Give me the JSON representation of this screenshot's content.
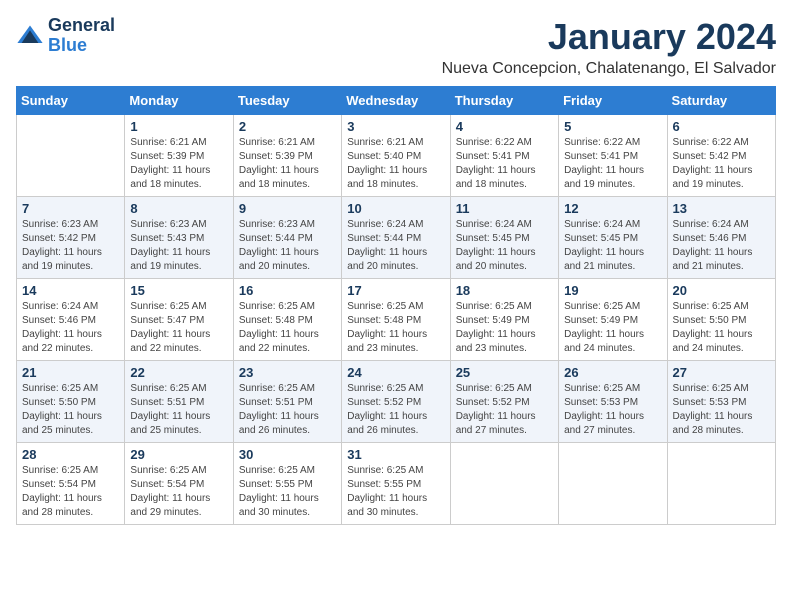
{
  "logo": {
    "line1": "General",
    "line2": "Blue"
  },
  "title": "January 2024",
  "location": "Nueva Concepcion, Chalatenango, El Salvador",
  "days_of_week": [
    "Sunday",
    "Monday",
    "Tuesday",
    "Wednesday",
    "Thursday",
    "Friday",
    "Saturday"
  ],
  "weeks": [
    [
      {
        "day": "",
        "info": ""
      },
      {
        "day": "1",
        "info": "Sunrise: 6:21 AM\nSunset: 5:39 PM\nDaylight: 11 hours\nand 18 minutes."
      },
      {
        "day": "2",
        "info": "Sunrise: 6:21 AM\nSunset: 5:39 PM\nDaylight: 11 hours\nand 18 minutes."
      },
      {
        "day": "3",
        "info": "Sunrise: 6:21 AM\nSunset: 5:40 PM\nDaylight: 11 hours\nand 18 minutes."
      },
      {
        "day": "4",
        "info": "Sunrise: 6:22 AM\nSunset: 5:41 PM\nDaylight: 11 hours\nand 18 minutes."
      },
      {
        "day": "5",
        "info": "Sunrise: 6:22 AM\nSunset: 5:41 PM\nDaylight: 11 hours\nand 19 minutes."
      },
      {
        "day": "6",
        "info": "Sunrise: 6:22 AM\nSunset: 5:42 PM\nDaylight: 11 hours\nand 19 minutes."
      }
    ],
    [
      {
        "day": "7",
        "info": "Sunrise: 6:23 AM\nSunset: 5:42 PM\nDaylight: 11 hours\nand 19 minutes."
      },
      {
        "day": "8",
        "info": "Sunrise: 6:23 AM\nSunset: 5:43 PM\nDaylight: 11 hours\nand 19 minutes."
      },
      {
        "day": "9",
        "info": "Sunrise: 6:23 AM\nSunset: 5:44 PM\nDaylight: 11 hours\nand 20 minutes."
      },
      {
        "day": "10",
        "info": "Sunrise: 6:24 AM\nSunset: 5:44 PM\nDaylight: 11 hours\nand 20 minutes."
      },
      {
        "day": "11",
        "info": "Sunrise: 6:24 AM\nSunset: 5:45 PM\nDaylight: 11 hours\nand 20 minutes."
      },
      {
        "day": "12",
        "info": "Sunrise: 6:24 AM\nSunset: 5:45 PM\nDaylight: 11 hours\nand 21 minutes."
      },
      {
        "day": "13",
        "info": "Sunrise: 6:24 AM\nSunset: 5:46 PM\nDaylight: 11 hours\nand 21 minutes."
      }
    ],
    [
      {
        "day": "14",
        "info": "Sunrise: 6:24 AM\nSunset: 5:46 PM\nDaylight: 11 hours\nand 22 minutes."
      },
      {
        "day": "15",
        "info": "Sunrise: 6:25 AM\nSunset: 5:47 PM\nDaylight: 11 hours\nand 22 minutes."
      },
      {
        "day": "16",
        "info": "Sunrise: 6:25 AM\nSunset: 5:48 PM\nDaylight: 11 hours\nand 22 minutes."
      },
      {
        "day": "17",
        "info": "Sunrise: 6:25 AM\nSunset: 5:48 PM\nDaylight: 11 hours\nand 23 minutes."
      },
      {
        "day": "18",
        "info": "Sunrise: 6:25 AM\nSunset: 5:49 PM\nDaylight: 11 hours\nand 23 minutes."
      },
      {
        "day": "19",
        "info": "Sunrise: 6:25 AM\nSunset: 5:49 PM\nDaylight: 11 hours\nand 24 minutes."
      },
      {
        "day": "20",
        "info": "Sunrise: 6:25 AM\nSunset: 5:50 PM\nDaylight: 11 hours\nand 24 minutes."
      }
    ],
    [
      {
        "day": "21",
        "info": "Sunrise: 6:25 AM\nSunset: 5:50 PM\nDaylight: 11 hours\nand 25 minutes."
      },
      {
        "day": "22",
        "info": "Sunrise: 6:25 AM\nSunset: 5:51 PM\nDaylight: 11 hours\nand 25 minutes."
      },
      {
        "day": "23",
        "info": "Sunrise: 6:25 AM\nSunset: 5:51 PM\nDaylight: 11 hours\nand 26 minutes."
      },
      {
        "day": "24",
        "info": "Sunrise: 6:25 AM\nSunset: 5:52 PM\nDaylight: 11 hours\nand 26 minutes."
      },
      {
        "day": "25",
        "info": "Sunrise: 6:25 AM\nSunset: 5:52 PM\nDaylight: 11 hours\nand 27 minutes."
      },
      {
        "day": "26",
        "info": "Sunrise: 6:25 AM\nSunset: 5:53 PM\nDaylight: 11 hours\nand 27 minutes."
      },
      {
        "day": "27",
        "info": "Sunrise: 6:25 AM\nSunset: 5:53 PM\nDaylight: 11 hours\nand 28 minutes."
      }
    ],
    [
      {
        "day": "28",
        "info": "Sunrise: 6:25 AM\nSunset: 5:54 PM\nDaylight: 11 hours\nand 28 minutes."
      },
      {
        "day": "29",
        "info": "Sunrise: 6:25 AM\nSunset: 5:54 PM\nDaylight: 11 hours\nand 29 minutes."
      },
      {
        "day": "30",
        "info": "Sunrise: 6:25 AM\nSunset: 5:55 PM\nDaylight: 11 hours\nand 30 minutes."
      },
      {
        "day": "31",
        "info": "Sunrise: 6:25 AM\nSunset: 5:55 PM\nDaylight: 11 hours\nand 30 minutes."
      },
      {
        "day": "",
        "info": ""
      },
      {
        "day": "",
        "info": ""
      },
      {
        "day": "",
        "info": ""
      }
    ]
  ],
  "colors": {
    "header_bg": "#2d7dd2",
    "title_color": "#1a3a5c"
  }
}
